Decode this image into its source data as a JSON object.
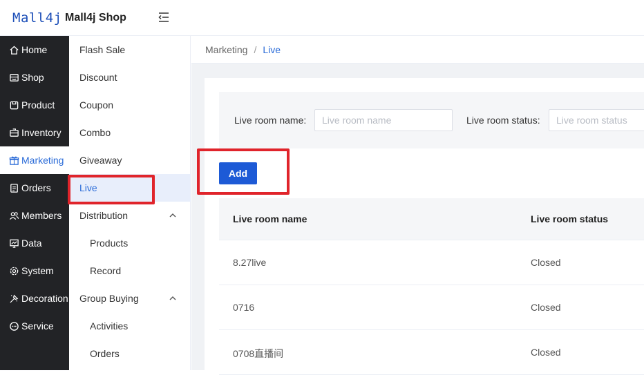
{
  "header": {
    "logo": "Mall4j",
    "shop_name": "Mall4j Shop"
  },
  "sidebar": {
    "items": [
      {
        "label": "Home",
        "icon": "home-icon"
      },
      {
        "label": "Shop",
        "icon": "shop-icon"
      },
      {
        "label": "Product",
        "icon": "product-icon"
      },
      {
        "label": "Inventory",
        "icon": "inventory-icon"
      },
      {
        "label": "Marketing",
        "icon": "gift-icon",
        "active": true
      },
      {
        "label": "Orders",
        "icon": "orders-icon"
      },
      {
        "label": "Members",
        "icon": "members-icon"
      },
      {
        "label": "Data",
        "icon": "data-icon"
      },
      {
        "label": "System",
        "icon": "gear-icon"
      },
      {
        "label": "Decoration",
        "icon": "decoration-icon"
      },
      {
        "label": "Service",
        "icon": "chat-icon"
      }
    ]
  },
  "submenu": {
    "items": [
      {
        "label": "Flash Sale"
      },
      {
        "label": "Discount"
      },
      {
        "label": "Coupon"
      },
      {
        "label": "Combo"
      },
      {
        "label": "Giveaway"
      },
      {
        "label": "Live",
        "active": true
      },
      {
        "label": "Distribution",
        "expanded": true
      },
      {
        "label": "Products",
        "child": true
      },
      {
        "label": "Record",
        "child": true
      },
      {
        "label": "Group Buying",
        "expanded": true
      },
      {
        "label": "Activities",
        "child": true
      },
      {
        "label": "Orders",
        "child": true
      }
    ]
  },
  "breadcrumb": {
    "parent": "Marketing",
    "separator": "/",
    "current": "Live"
  },
  "search": {
    "name_label": "Live room name:",
    "name_placeholder": "Live room name",
    "status_label": "Live room status:",
    "status_placeholder": "Live room status"
  },
  "add_label": "Add",
  "table": {
    "headers": [
      "Live room name",
      "Live room status"
    ],
    "rows": [
      [
        "8.27live",
        "Closed"
      ],
      [
        "0716",
        "Closed"
      ],
      [
        "0708直播间",
        "Closed"
      ]
    ]
  },
  "colors": {
    "accent": "#2a6bd8",
    "primary_button": "#1d5ad6",
    "sidebar_bg": "#222326",
    "highlight": "#e0242b"
  }
}
